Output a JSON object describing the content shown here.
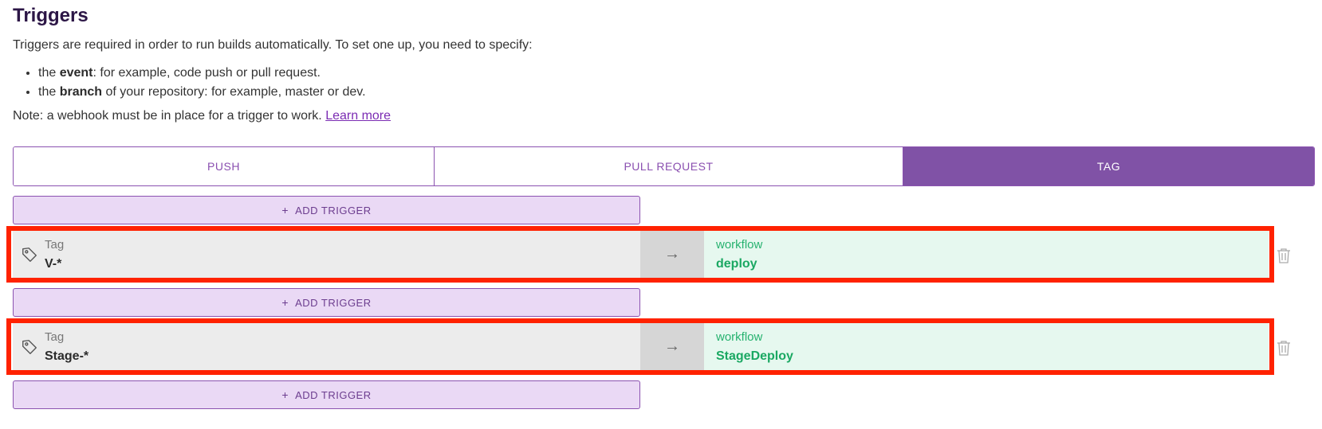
{
  "page": {
    "title": "Triggers",
    "intro": "Triggers are required in order to run builds automatically. To set one up, you need to specify:",
    "bullets": [
      {
        "prefix": "the ",
        "bold": "event",
        "suffix": ": for example, code push or pull request."
      },
      {
        "prefix": "the ",
        "bold": "branch",
        "suffix": " of your repository: for example, master or dev."
      }
    ],
    "note": "Note: a webhook must be in place for a trigger to work. ",
    "learn_more": "Learn more"
  },
  "tabs": [
    {
      "label": "PUSH",
      "active": false
    },
    {
      "label": "PULL REQUEST",
      "active": false
    },
    {
      "label": "TAG",
      "active": true
    }
  ],
  "add_trigger_label": "ADD TRIGGER",
  "add_trigger_plus": "+",
  "arrow_glyph": "→",
  "triggers": [
    {
      "source_label": "Tag",
      "source_value": "V-*",
      "target_label": "workflow",
      "target_value": "deploy",
      "highlighted": true
    },
    {
      "source_label": "Tag",
      "source_value": "Stage-*",
      "target_label": "workflow",
      "target_value": "StageDeploy",
      "highlighted": true
    }
  ],
  "colors": {
    "accent": "#8052a6",
    "highlight": "#ff2200",
    "workflow_green": "#1aa862"
  },
  "icons": [
    "tag-icon",
    "arrow-right-icon",
    "trash-icon",
    "plus-icon"
  ]
}
